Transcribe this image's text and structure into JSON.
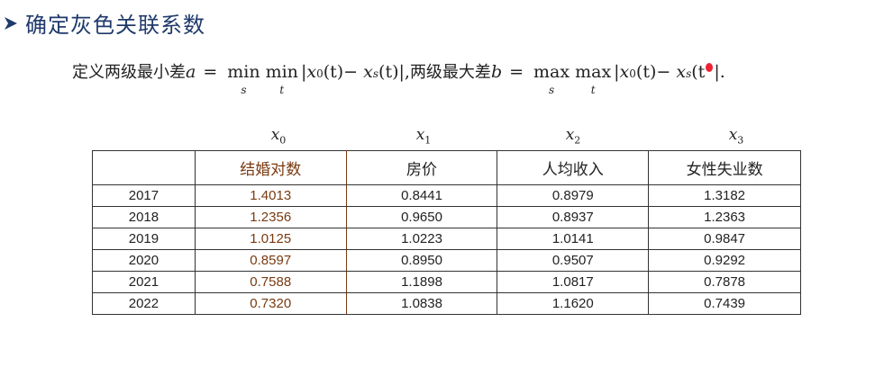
{
  "heading": {
    "text": "确定灰色关联系数"
  },
  "formula": {
    "define_a": "定义两级最小差",
    "a_var": "a",
    "eq": "=",
    "min": "min",
    "s": "s",
    "t": "t",
    "abs_a": "|x",
    "sub0": "0",
    "t_paren": "(t)",
    "minus": " − x",
    "subs": "s",
    "t_close": "(t)|,",
    "define_b": "两级最大差",
    "b_var": "b",
    "max": "max",
    "t_paren2": "(t",
    "end": "|."
  },
  "variables": [
    {
      "base": "x",
      "sub": "0"
    },
    {
      "base": "x",
      "sub": "1"
    },
    {
      "base": "x",
      "sub": "2"
    },
    {
      "base": "x",
      "sub": "3"
    }
  ],
  "table": {
    "headers": [
      "",
      "结婚对数",
      "房价",
      "人均收入",
      "女性失业数"
    ],
    "rows": [
      [
        "2017",
        "1.4013",
        "0.8441",
        "0.8979",
        "1.3182"
      ],
      [
        "2018",
        "1.2356",
        "0.9650",
        "0.8937",
        "1.2363"
      ],
      [
        "2019",
        "1.0125",
        "1.0223",
        "1.0141",
        "0.9847"
      ],
      [
        "2020",
        "0.8597",
        "0.8950",
        "0.9507",
        "0.9292"
      ],
      [
        "2021",
        "0.7588",
        "1.1898",
        "1.0817",
        "0.7878"
      ],
      [
        "2022",
        "0.7320",
        "1.0838",
        "1.1620",
        "0.7439"
      ]
    ]
  },
  "colors": {
    "heading": "#1f3a6b",
    "accent": "#7a3a10"
  }
}
